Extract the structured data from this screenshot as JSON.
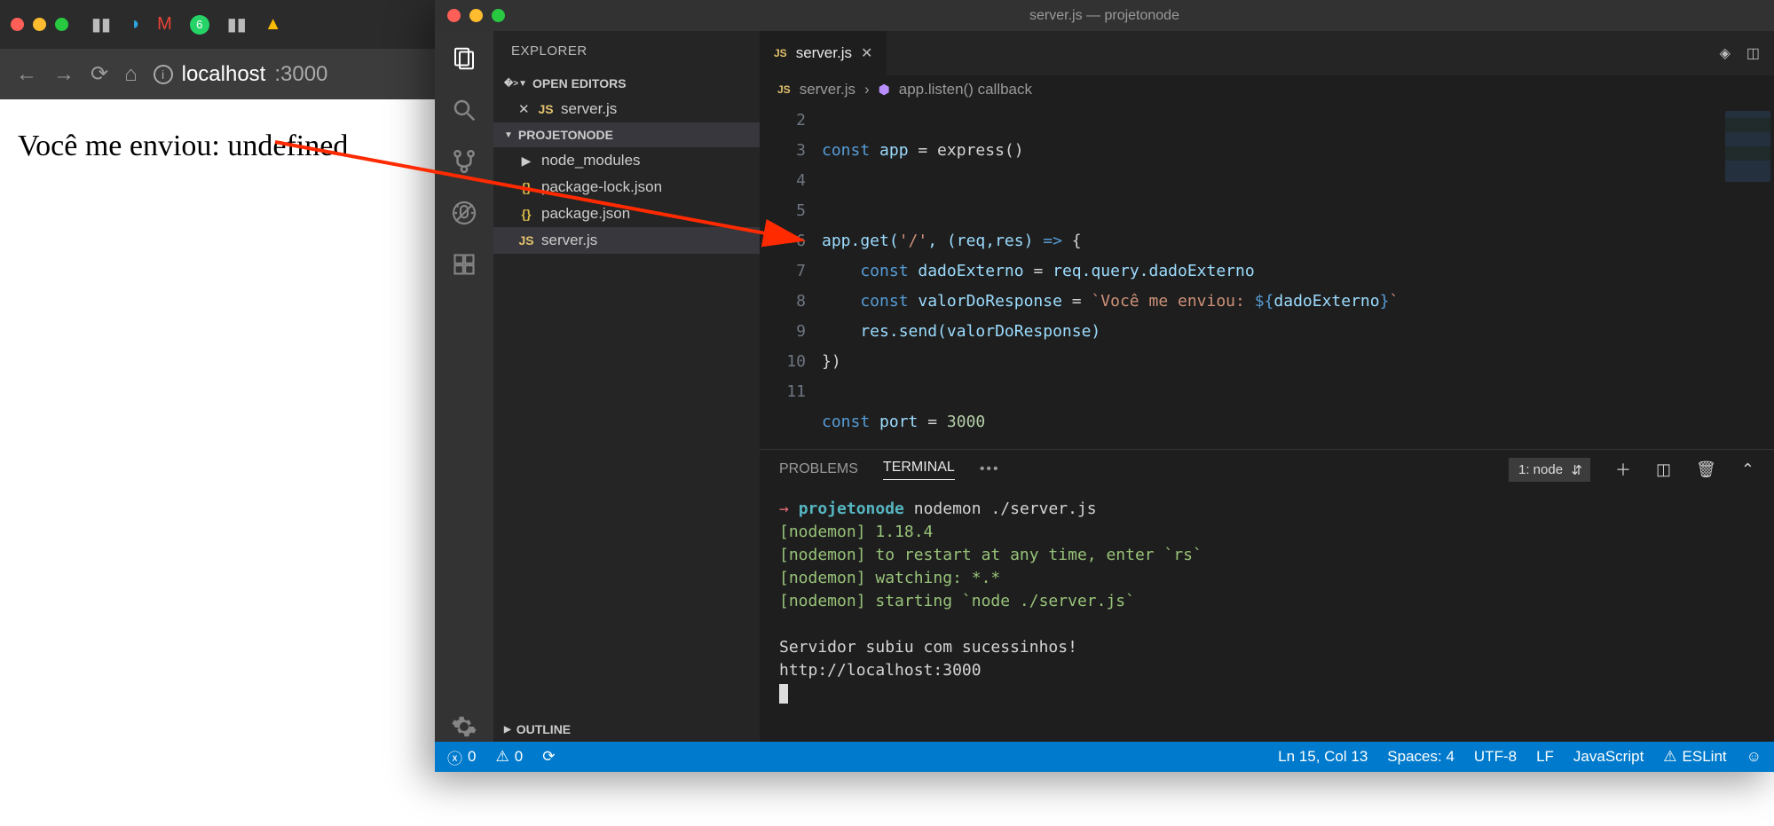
{
  "browser": {
    "address_host": "localhost",
    "address_port": ":3000",
    "page_text": "Você me enviou: undefined"
  },
  "vscode": {
    "title": "server.js — projetonode",
    "explorer_label": "EXPLORER",
    "open_editors_label": "OPEN EDITORS",
    "project_label": "PROJETONODE",
    "outline_label": "OUTLINE",
    "open_editors": [
      {
        "name": "server.js",
        "icon": "JS"
      }
    ],
    "files": [
      {
        "name": "node_modules",
        "icon": "▶",
        "type": "folder"
      },
      {
        "name": "package-lock.json",
        "icon": "{}",
        "type": "json"
      },
      {
        "name": "package.json",
        "icon": "{}",
        "type": "json"
      },
      {
        "name": "server.js",
        "icon": "JS",
        "type": "js",
        "selected": true
      }
    ],
    "tab_name": "server.js",
    "breadcrumb": {
      "file": "server.js",
      "symbol": "app.listen() callback"
    },
    "gutter": [
      "2",
      "3",
      "4",
      "5",
      "6",
      "7",
      "8",
      "9",
      "10",
      "11"
    ],
    "code_lines": {
      "l2a": "const",
      "l2b": " app ",
      "l2c": "=",
      "l2d": " express()",
      "l5a": "app.get(",
      "l5b": "'/'",
      "l5c": ", (req,res) ",
      "l5d": "=>",
      "l5e": " {",
      "l6a": "    const",
      "l6b": " dadoExterno ",
      "l6c": "=",
      "l6d": " req.query.dadoExterno",
      "l7a": "    const",
      "l7b": " valorDoResponse ",
      "l7c": "=",
      "l7d": " `Você me enviou: ",
      "l7e": "${",
      "l7f": "dadoExterno",
      "l7g": "}",
      "l7h": "`",
      "l8a": "    res.send(valorDoResponse)",
      "l9a": "})",
      "l11a": "const",
      "l11b": " port ",
      "l11c": "=",
      "l11d": " 3000"
    },
    "panel": {
      "tabs": {
        "problems": "PROBLEMS",
        "terminal": "TERMINAL"
      },
      "select": "1: node",
      "lines": {
        "arrow": "→",
        "proj": "projetonode",
        "cmd": " nodemon ./server.js",
        "n1": "[nodemon] 1.18.4",
        "n2": "[nodemon] to restart at any time, enter `rs`",
        "n3": "[nodemon] watching: *.*",
        "n4": "[nodemon] starting `node ./server.js`",
        "s1": "    Servidor subiu com sucessinhos!",
        "s2": "    http://localhost:3000"
      }
    },
    "status": {
      "errors": "0",
      "warnings": "0",
      "position": "Ln 15, Col 13",
      "spaces": "Spaces: 4",
      "encoding": "UTF-8",
      "eol": "LF",
      "language": "JavaScript",
      "eslint": "ESLint"
    }
  }
}
